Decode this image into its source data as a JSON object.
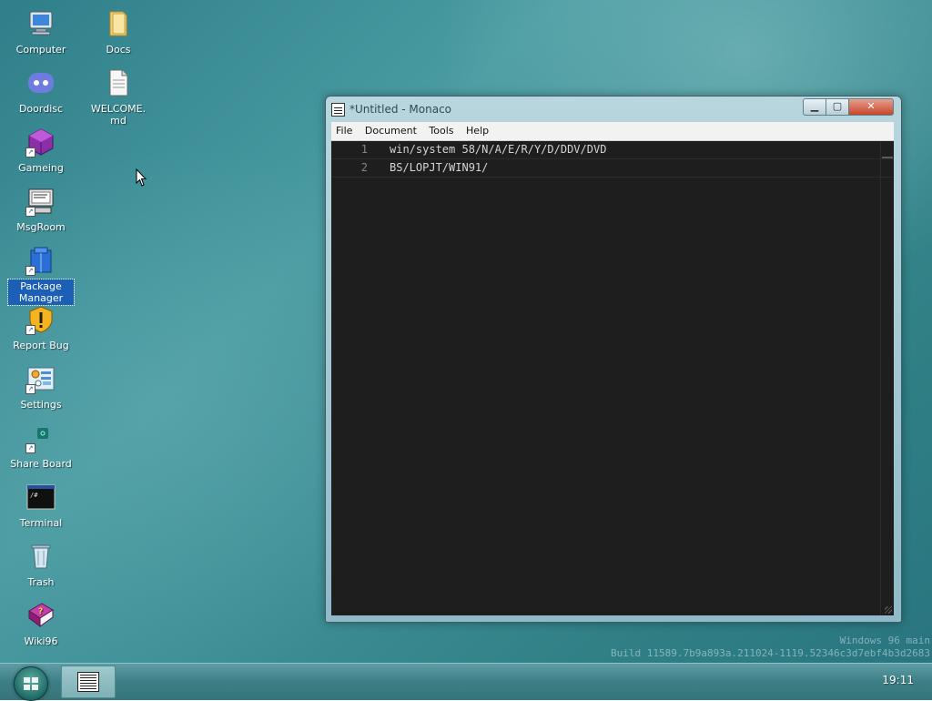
{
  "desktop": {
    "icons": [
      {
        "label": "Computer",
        "icon": "computer-icon"
      },
      {
        "label": "Docs",
        "icon": "folder-icon"
      },
      {
        "label": "Doordisc",
        "icon": "doordisc-icon"
      },
      {
        "label": "WELCOME.\nmd",
        "icon": "text-file-icon"
      },
      {
        "label": "Gameing",
        "icon": "game-cube-icon"
      },
      {
        "label": "MsgRoom",
        "icon": "msgroom-icon"
      },
      {
        "label": "Package\nManager",
        "icon": "package-icon"
      },
      {
        "label": "Report Bug",
        "icon": "warning-shield-icon"
      },
      {
        "label": "Settings",
        "icon": "settings-icon"
      },
      {
        "label": "Share Board",
        "icon": "share-board-icon"
      },
      {
        "label": "Terminal",
        "icon": "terminal-icon"
      },
      {
        "label": "Trash",
        "icon": "trash-icon"
      },
      {
        "label": "Wiki96",
        "icon": "wiki-book-icon"
      }
    ]
  },
  "window": {
    "title": "*Untitled - Monaco",
    "menu": [
      "File",
      "Document",
      "Tools",
      "Help"
    ],
    "editor": {
      "lines": [
        {
          "number": "1",
          "text": "win/system 58/N/A/E/R/Y/D/DDV/DVD"
        },
        {
          "number": "2",
          "text": "BS/LOPJT/WIN91/"
        }
      ]
    }
  },
  "watermark": {
    "line1": "Windows 96 main",
    "line2": "Build 11589.7b9a893a.211024-1119.52346c3d7ebf4b3d2683"
  },
  "taskbar": {
    "clock": "19:11"
  },
  "colors": {
    "desktop_bg": "#3d8e95",
    "taskbar_bg": "#3d7f86",
    "editor_bg": "#1e1e1e",
    "selection": "#1b5fb6",
    "close_button": "#c8452a"
  }
}
